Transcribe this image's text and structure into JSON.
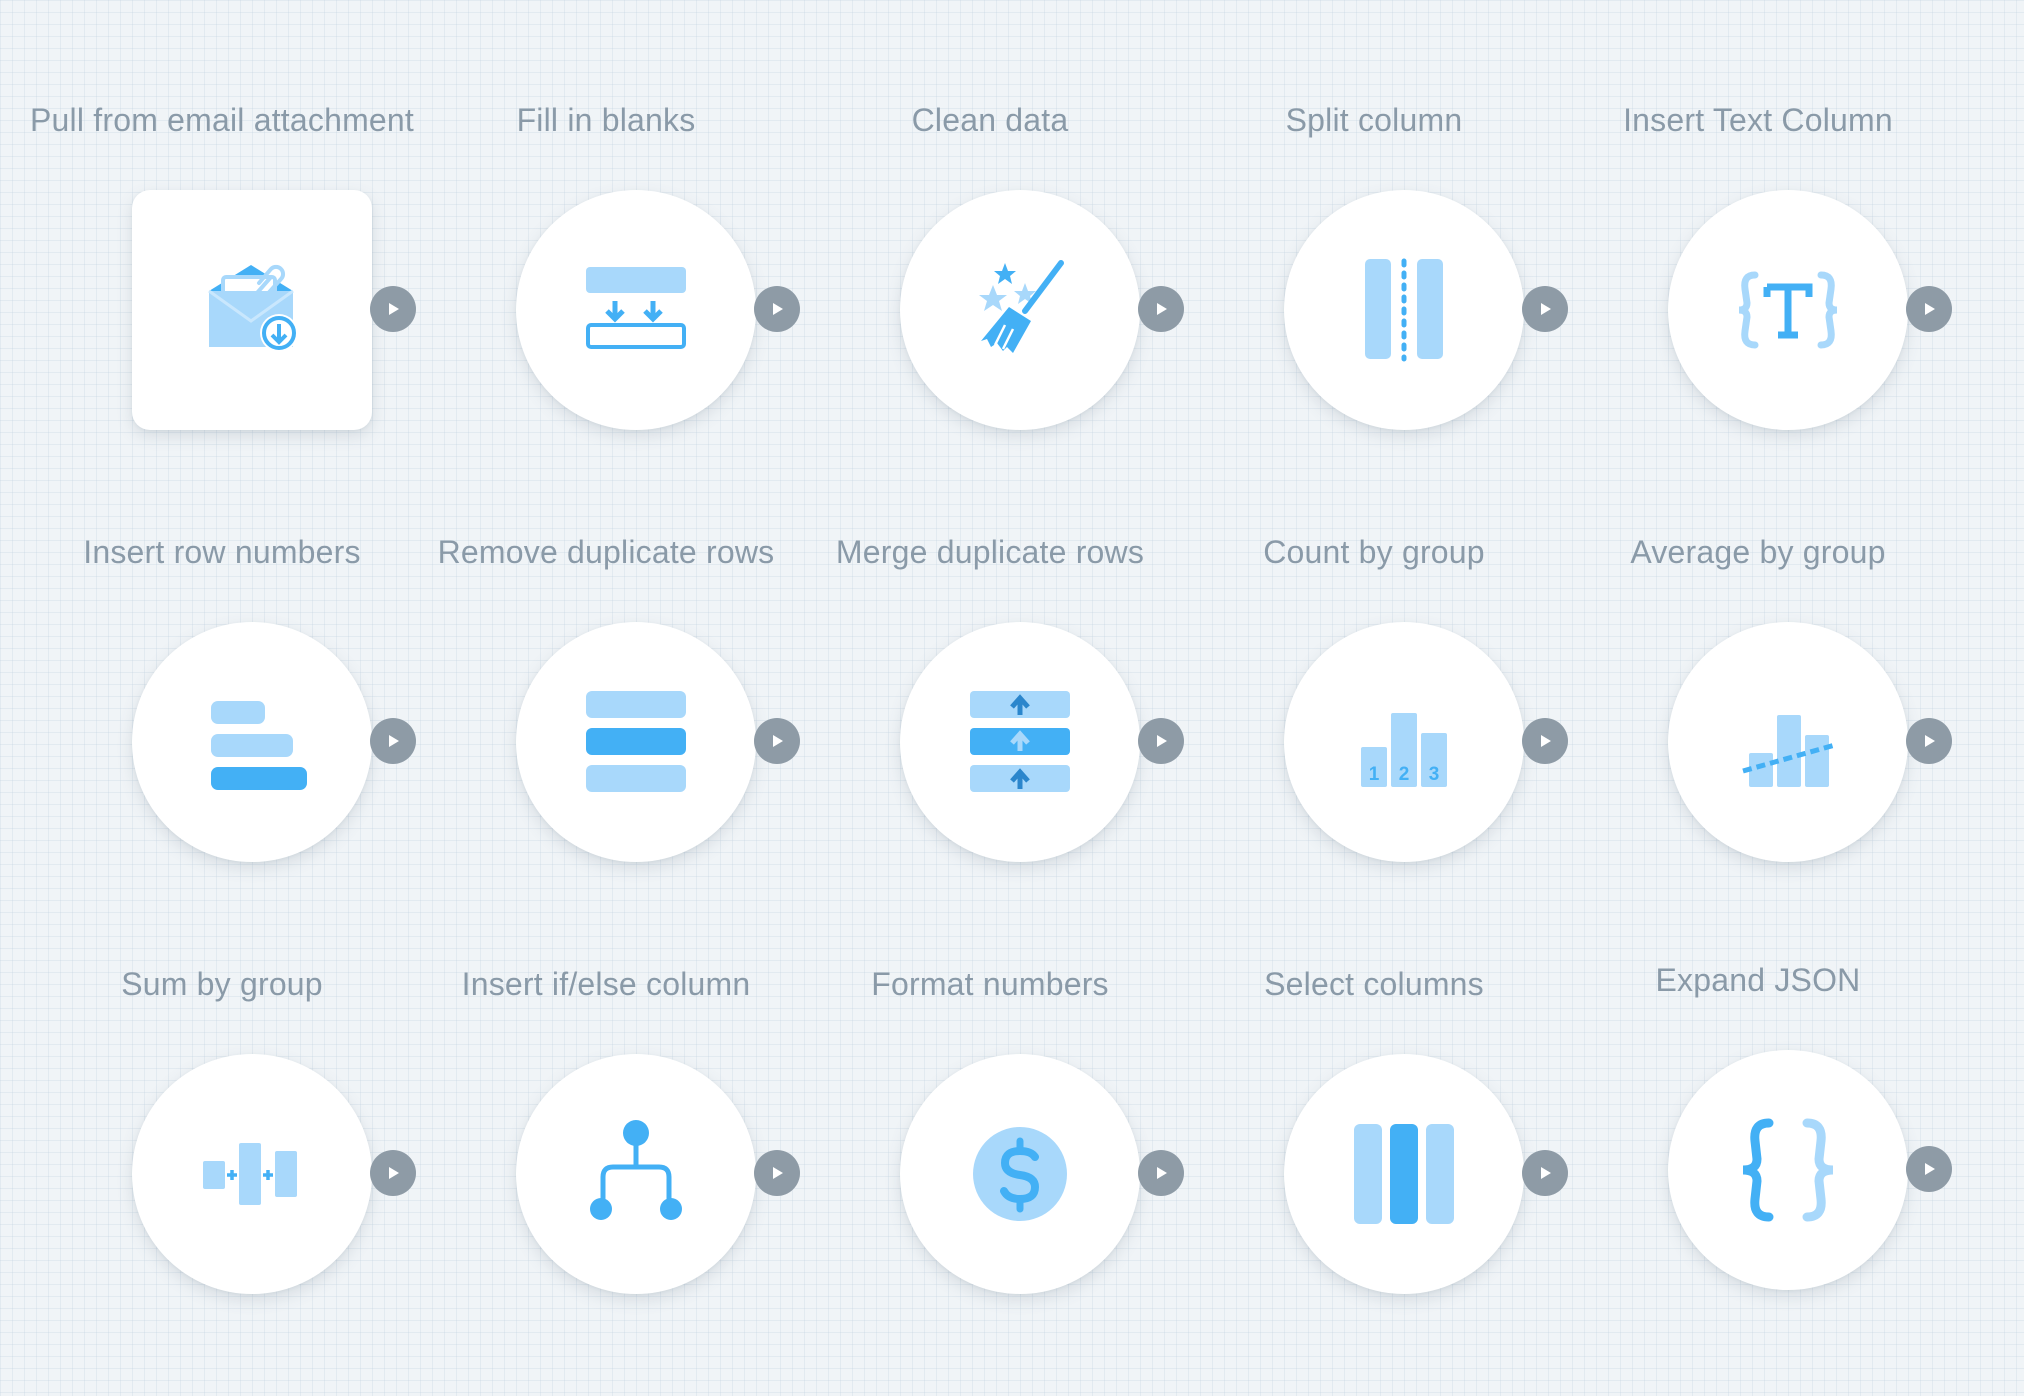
{
  "colors": {
    "background": "#f0f4f7",
    "card": "#ffffff",
    "label": "#8a9aa8",
    "icon_light": "#a8d8fb",
    "icon_dark": "#43b0f5",
    "run_button": "#8e9ba6"
  },
  "nodes": [
    {
      "label": "Pull from email attachment",
      "icon": "email-attachment-icon",
      "shape": "square"
    },
    {
      "label": "Fill in blanks",
      "icon": "fill-blanks-icon",
      "shape": "circle"
    },
    {
      "label": "Clean data",
      "icon": "broom-icon",
      "shape": "circle"
    },
    {
      "label": "Split column",
      "icon": "split-column-icon",
      "shape": "circle"
    },
    {
      "label": "Insert Text Column",
      "icon": "text-column-icon",
      "shape": "circle"
    },
    {
      "label": "Insert row numbers",
      "icon": "row-numbers-icon",
      "shape": "circle"
    },
    {
      "label": "Remove duplicate rows",
      "icon": "remove-duplicates-icon",
      "shape": "circle"
    },
    {
      "label": "Merge duplicate rows",
      "icon": "merge-duplicates-icon",
      "shape": "circle"
    },
    {
      "label": "Count by group",
      "icon": "count-by-group-icon",
      "shape": "circle",
      "digits": [
        "1",
        "2",
        "3"
      ]
    },
    {
      "label": "Average by group",
      "icon": "average-by-group-icon",
      "shape": "circle"
    },
    {
      "label": "Sum by group",
      "icon": "sum-by-group-icon",
      "shape": "circle"
    },
    {
      "label": "Insert if/else column",
      "icon": "branch-icon",
      "shape": "circle"
    },
    {
      "label": "Format numbers",
      "icon": "dollar-icon",
      "shape": "circle"
    },
    {
      "label": "Select columns",
      "icon": "select-columns-icon",
      "shape": "circle"
    },
    {
      "label": "Expand JSON",
      "icon": "curly-braces-icon",
      "shape": "circle"
    }
  ]
}
